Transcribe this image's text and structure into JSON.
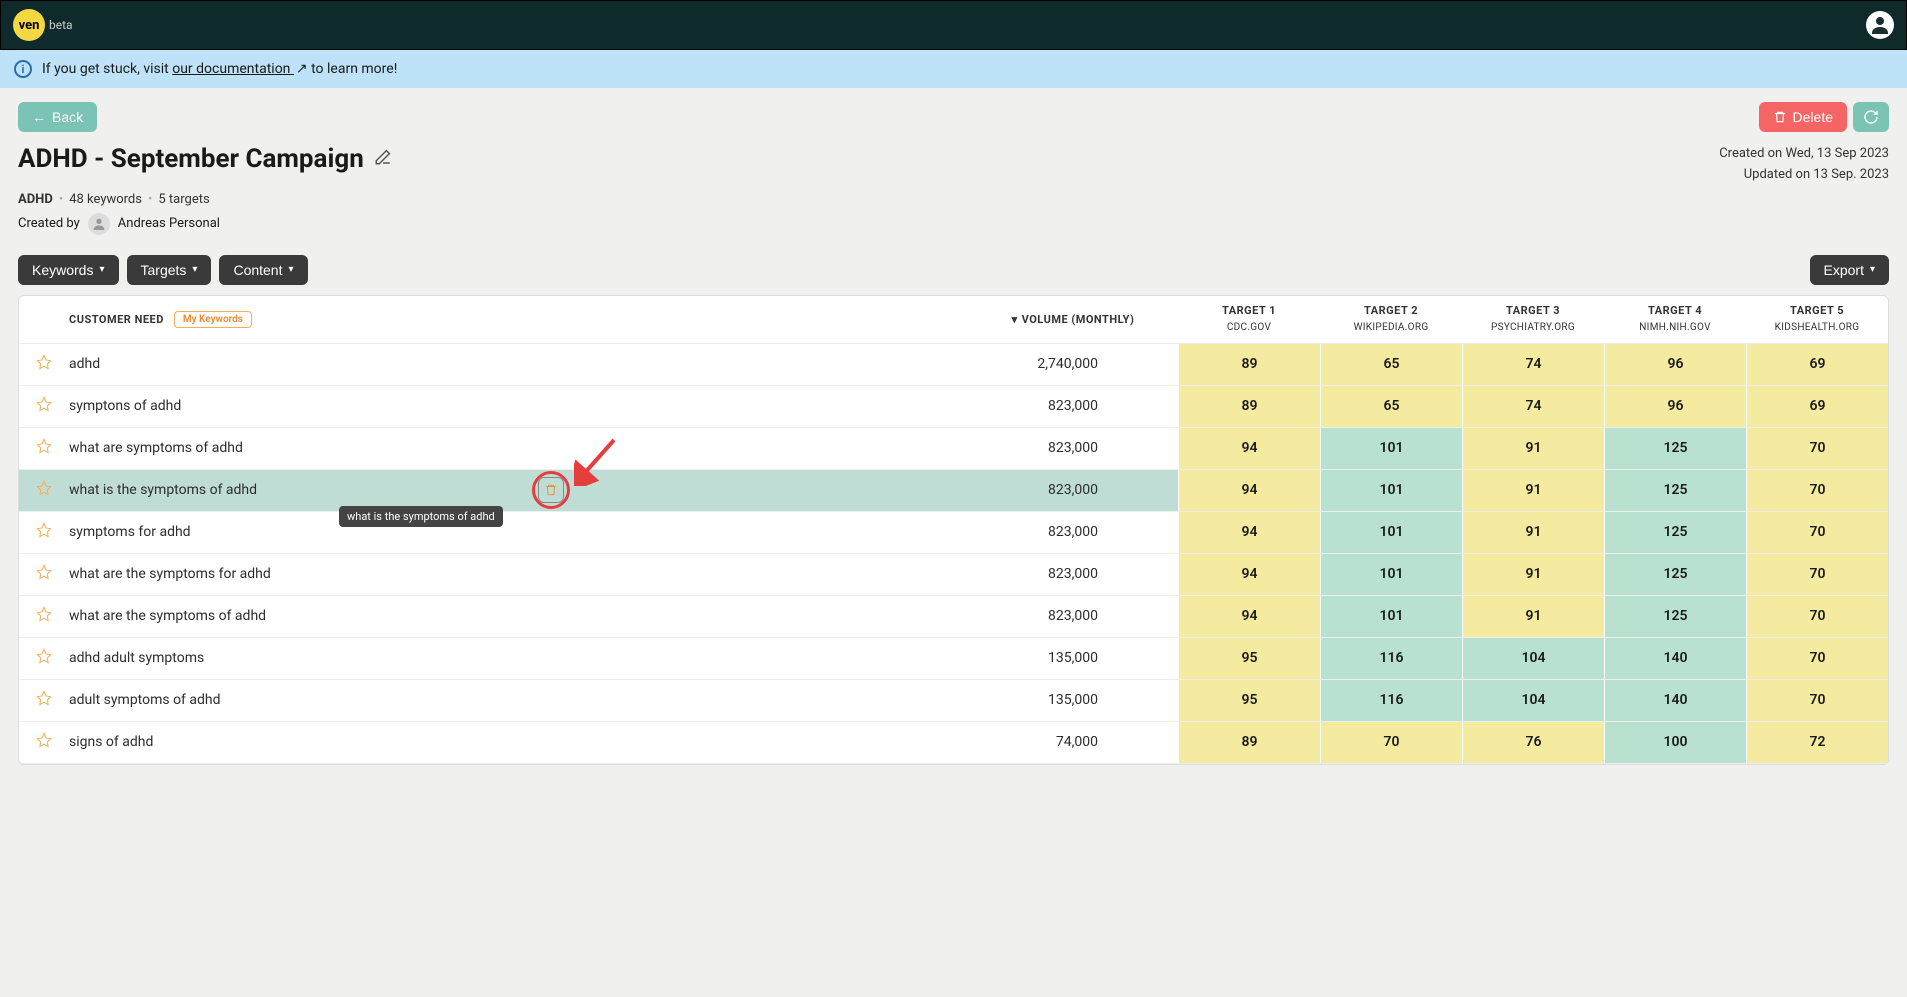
{
  "app": {
    "logo": "ven",
    "beta": "beta"
  },
  "banner": {
    "pre": "If you get stuck, visit ",
    "link": "our documentation",
    "post": " to learn more!"
  },
  "buttons": {
    "back": "Back",
    "delete": "Delete",
    "keywords": "Keywords",
    "targets": "Targets",
    "content": "Content",
    "export": "Export"
  },
  "title": "ADHD - September Campaign",
  "dates": {
    "created": "Created on Wed, 13 Sep 2023",
    "updated": "Updated on 13 Sep. 2023"
  },
  "meta": {
    "topic": "ADHD",
    "keywords": "48 keywords",
    "targets": "5 targets"
  },
  "creator": {
    "label": "Created by",
    "name": "Andreas Personal"
  },
  "headers": {
    "customer_need": "CUSTOMER NEED",
    "my_keywords": "My Keywords",
    "volume": "VOLUME (MONTHLY)",
    "targets": [
      {
        "label": "TARGET 1",
        "domain": "CDC.GOV"
      },
      {
        "label": "TARGET 2",
        "domain": "WIKIPEDIA.ORG"
      },
      {
        "label": "TARGET 3",
        "domain": "PSYCHIATRY.ORG"
      },
      {
        "label": "TARGET 4",
        "domain": "NIMH.NIH.GOV"
      },
      {
        "label": "TARGET 5",
        "domain": "KIDSHEALTH.ORG"
      }
    ]
  },
  "tooltip": "what is the symptoms of adhd",
  "rows": [
    {
      "kw": "adhd",
      "vol": "2,740,000",
      "s": [
        {
          "v": "89",
          "c": "yellow"
        },
        {
          "v": "65",
          "c": "yellow"
        },
        {
          "v": "74",
          "c": "yellow"
        },
        {
          "v": "96",
          "c": "yellow"
        },
        {
          "v": "69",
          "c": "yellow"
        }
      ]
    },
    {
      "kw": "symptons of adhd",
      "vol": "823,000",
      "s": [
        {
          "v": "89",
          "c": "yellow"
        },
        {
          "v": "65",
          "c": "yellow"
        },
        {
          "v": "74",
          "c": "yellow"
        },
        {
          "v": "96",
          "c": "yellow"
        },
        {
          "v": "69",
          "c": "yellow"
        }
      ]
    },
    {
      "kw": "what are symptoms of adhd",
      "vol": "823,000",
      "s": [
        {
          "v": "94",
          "c": "yellow"
        },
        {
          "v": "101",
          "c": "green"
        },
        {
          "v": "91",
          "c": "yellow"
        },
        {
          "v": "125",
          "c": "green"
        },
        {
          "v": "70",
          "c": "yellow"
        }
      ]
    },
    {
      "kw": "what is the symptoms of adhd",
      "vol": "823,000",
      "hl": true,
      "s": [
        {
          "v": "94",
          "c": "yellow"
        },
        {
          "v": "101",
          "c": "green"
        },
        {
          "v": "91",
          "c": "yellow"
        },
        {
          "v": "125",
          "c": "green"
        },
        {
          "v": "70",
          "c": "yellow"
        }
      ]
    },
    {
      "kw": "symptoms for adhd",
      "vol": "823,000",
      "s": [
        {
          "v": "94",
          "c": "yellow"
        },
        {
          "v": "101",
          "c": "green"
        },
        {
          "v": "91",
          "c": "yellow"
        },
        {
          "v": "125",
          "c": "green"
        },
        {
          "v": "70",
          "c": "yellow"
        }
      ]
    },
    {
      "kw": "what are the symptoms for adhd",
      "vol": "823,000",
      "s": [
        {
          "v": "94",
          "c": "yellow"
        },
        {
          "v": "101",
          "c": "green"
        },
        {
          "v": "91",
          "c": "yellow"
        },
        {
          "v": "125",
          "c": "green"
        },
        {
          "v": "70",
          "c": "yellow"
        }
      ]
    },
    {
      "kw": "what are the symptoms of adhd",
      "vol": "823,000",
      "s": [
        {
          "v": "94",
          "c": "yellow"
        },
        {
          "v": "101",
          "c": "green"
        },
        {
          "v": "91",
          "c": "yellow"
        },
        {
          "v": "125",
          "c": "green"
        },
        {
          "v": "70",
          "c": "yellow"
        }
      ]
    },
    {
      "kw": "adhd adult symptoms",
      "vol": "135,000",
      "s": [
        {
          "v": "95",
          "c": "yellow"
        },
        {
          "v": "116",
          "c": "green"
        },
        {
          "v": "104",
          "c": "green"
        },
        {
          "v": "140",
          "c": "green"
        },
        {
          "v": "70",
          "c": "yellow"
        }
      ]
    },
    {
      "kw": "adult symptoms of adhd",
      "vol": "135,000",
      "s": [
        {
          "v": "95",
          "c": "yellow"
        },
        {
          "v": "116",
          "c": "green"
        },
        {
          "v": "104",
          "c": "green"
        },
        {
          "v": "140",
          "c": "green"
        },
        {
          "v": "70",
          "c": "yellow"
        }
      ]
    },
    {
      "kw": "signs of adhd",
      "vol": "74,000",
      "s": [
        {
          "v": "89",
          "c": "yellow"
        },
        {
          "v": "70",
          "c": "yellow"
        },
        {
          "v": "76",
          "c": "yellow"
        },
        {
          "v": "100",
          "c": "green"
        },
        {
          "v": "72",
          "c": "yellow"
        }
      ]
    }
  ]
}
